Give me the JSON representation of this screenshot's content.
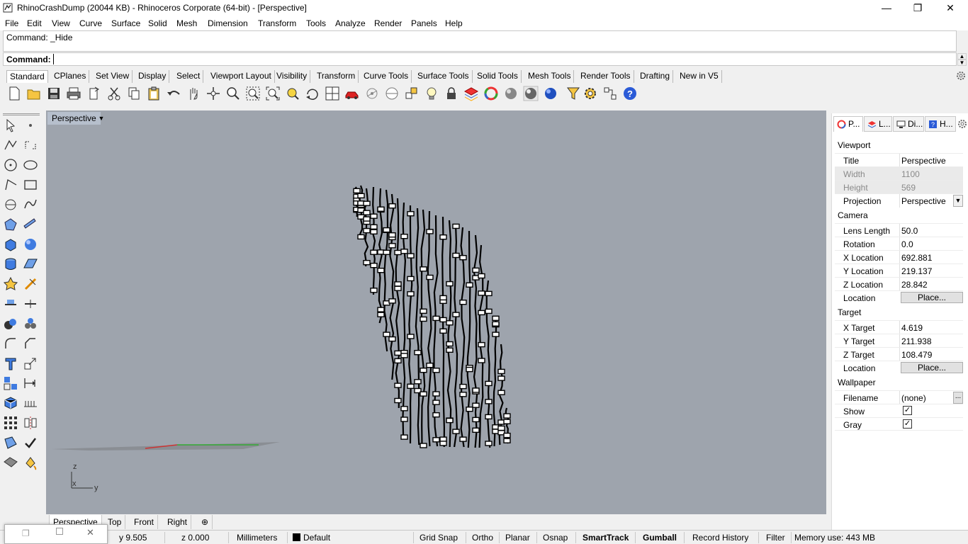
{
  "window": {
    "title": "RhinoCrashDump (20044 KB) - Rhinoceros Corporate (64-bit) - [Perspective]",
    "minimize_glyph": "—",
    "maximize_glyph": "❐",
    "close_glyph": "✕"
  },
  "menu": [
    "File",
    "Edit",
    "View",
    "Curve",
    "Surface",
    "Solid",
    "Mesh",
    "Dimension",
    "Transform",
    "Tools",
    "Analyze",
    "Render",
    "Panels",
    "Help"
  ],
  "command": {
    "history": "Command: _Hide",
    "prompt_label": "Command:",
    "input_value": ""
  },
  "tool_tabs": [
    "Standard",
    "CPlanes",
    "Set View",
    "Display",
    "Select",
    "Viewport Layout",
    "Visibility",
    "Transform",
    "Curve Tools",
    "Surface Tools",
    "Solid Tools",
    "Mesh Tools",
    "Render Tools",
    "Drafting",
    "New in V5"
  ],
  "toolbar_icons": [
    "new-icon",
    "open-icon",
    "save-icon",
    "print-icon",
    "import-icon",
    "cut-icon",
    "copy-icon",
    "paste-icon",
    "undo-icon",
    "pan-icon",
    "rotate-view-icon",
    "zoom-dynamic-icon",
    "zoom-window-icon",
    "zoom-extents-icon",
    "zoom-selected-icon",
    "rotate-3d-icon",
    "four-viewports-icon",
    "car-icon",
    "camera-icon",
    "cplane-icon",
    "snap-icon",
    "light-bulb-icon",
    "lock-icon",
    "layer-icon",
    "color-wheel-icon",
    "shaded-sphere-icon",
    "rendered-sphere-icon",
    "ghosted-sphere-icon",
    "blue-sphere-icon",
    "filter-icon",
    "settings-gear-icon",
    "grid-options-icon",
    "help-icon"
  ],
  "left_toolbar_icons": [
    "select-arrow-icon",
    "point-icon",
    "polyline-icon",
    "curve-points-icon",
    "circle-icon",
    "ellipse-icon",
    "arc-icon",
    "rectangle-icon",
    "polygon-icon",
    "freeform-curve-icon",
    "surface-corner-icon",
    "extrude-curve-icon",
    "box-icon",
    "sphere-icon",
    "cylinder-icon",
    "mesh-surface-icon",
    "explode-icon",
    "trim-icon",
    "split-icon",
    "join-icon",
    "boolean-union-icon",
    "boolean-split-icon",
    "fillet-icon",
    "chamfer-icon",
    "text-icon",
    "scale-icon",
    "group-icon",
    "dimension-icon",
    "block-icon",
    "array-icon",
    "array-grid-icon",
    "mirror-icon",
    "orient-icon",
    "check-icon",
    "render-preview-icon",
    "paint-bucket-icon"
  ],
  "viewport": {
    "label": "Perspective",
    "dropdown_glyph": "▼",
    "axis_z": "z",
    "axis_x": "x",
    "axis_y": "y",
    "background": "#9ea4ad"
  },
  "viewport_tabs": [
    "Perspective",
    "Top",
    "Front",
    "Right"
  ],
  "viewport_add_glyph": "⊕",
  "panel": {
    "tabs": [
      "P...",
      "L...",
      "Di...",
      "H..."
    ],
    "sections": {
      "viewport": "Viewport",
      "camera": "Camera",
      "target": "Target",
      "wallpaper": "Wallpaper"
    },
    "viewport_rows": [
      {
        "key": "Title",
        "value": "Perspective"
      },
      {
        "key": "Width",
        "value": "1100"
      },
      {
        "key": "Height",
        "value": "569"
      },
      {
        "key": "Projection",
        "value": "Perspective"
      }
    ],
    "camera_rows": [
      {
        "key": "Lens Length",
        "value": "50.0"
      },
      {
        "key": "Rotation",
        "value": "0.0"
      },
      {
        "key": "X Location",
        "value": "692.881"
      },
      {
        "key": "Y Location",
        "value": "219.137"
      },
      {
        "key": "Z Location",
        "value": "28.842"
      },
      {
        "key": "Location",
        "value": "Place..."
      }
    ],
    "target_rows": [
      {
        "key": "X Target",
        "value": "4.619"
      },
      {
        "key": "Y Target",
        "value": "211.938"
      },
      {
        "key": "Z Target",
        "value": "108.479"
      },
      {
        "key": "Location",
        "value": "Place..."
      }
    ],
    "wallpaper_rows": [
      {
        "key": "Filename",
        "value": "(none)"
      },
      {
        "key": "Show",
        "value": "✓"
      },
      {
        "key": "Gray",
        "value": "✓"
      }
    ],
    "dots_glyph": "...",
    "dropdown_glyph": "▼"
  },
  "status": {
    "y": "y 9.505",
    "z": "z 0.000",
    "units": "Millimeters",
    "layer": "Default",
    "toggles": [
      "Grid Snap",
      "Ortho",
      "Planar",
      "Osnap",
      "SmartTrack",
      "Gumball",
      "Record History",
      "Filter"
    ],
    "memory": "Memory use: 443 MB"
  }
}
